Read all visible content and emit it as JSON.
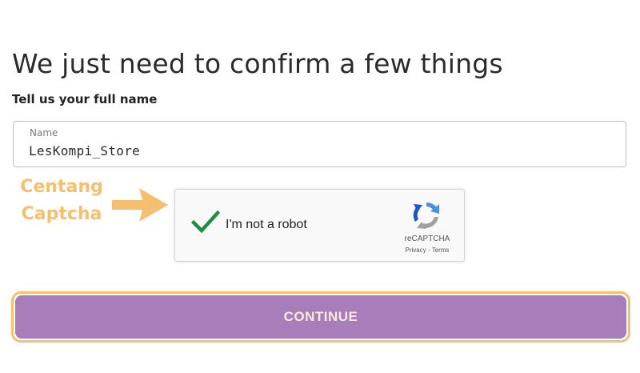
{
  "form": {
    "title": "We just need to confirm a few things",
    "subtitle": "Tell us your full name",
    "name_field": {
      "label": "Name",
      "value": "LesKompi_Store"
    },
    "continue_label": "CONTINUE"
  },
  "recaptcha": {
    "label": "I'm not a robot",
    "brand": "reCAPTCHA",
    "privacy": "Privacy",
    "separator": " - ",
    "terms": "Terms",
    "checked": true
  },
  "annotation": {
    "line1": "Centang",
    "line2": "Captcha"
  },
  "colors": {
    "annotation": "#f4c06f",
    "button": "#a77dba",
    "button_text": "#f7ecd9",
    "checkmark": "#1e8e3e"
  },
  "icons": {
    "arrow": "annotation-arrow-icon",
    "check": "checkmark-icon",
    "recaptcha": "recaptcha-logo-icon"
  }
}
